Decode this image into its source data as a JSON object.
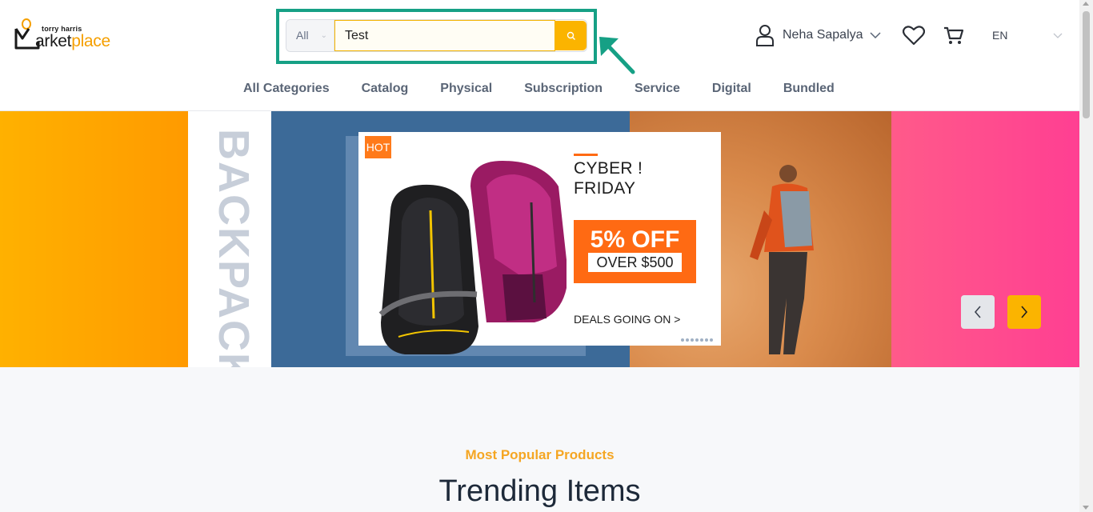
{
  "header": {
    "logo": {
      "small_text": "torry harris",
      "brand_prefix": "M",
      "brand_main": "arket",
      "brand_accent": "place"
    },
    "search": {
      "category": "All",
      "value": "Test",
      "icon": "search-icon"
    },
    "user": {
      "name": "Neha Sapalya",
      "icon": "user-icon"
    },
    "wishlist_icon": "heart-icon",
    "cart_icon": "cart-icon",
    "language": "EN"
  },
  "nav": {
    "items": [
      "All Categories",
      "Catalog",
      "Physical",
      "Subscription",
      "Service",
      "Digital",
      "Bundled"
    ]
  },
  "hero": {
    "vertical_text": "BACKPACK",
    "badge": "HOT",
    "title_line1": "CYBER !",
    "title_line2": "FRIDAY",
    "discount": "5% OFF",
    "threshold": "OVER $500",
    "cta": "DEALS GOING ON >",
    "prev_icon": "chevron-left-icon",
    "next_icon": "chevron-right-icon"
  },
  "trending": {
    "subtitle": "Most Popular Products",
    "title": "Trending Items"
  },
  "colors": {
    "accent": "#fbb400",
    "highlight": "#16a085",
    "promo_orange": "#ff6a13",
    "hero_blue": "#3c6a98",
    "hero_pink": "#ff3f92"
  }
}
